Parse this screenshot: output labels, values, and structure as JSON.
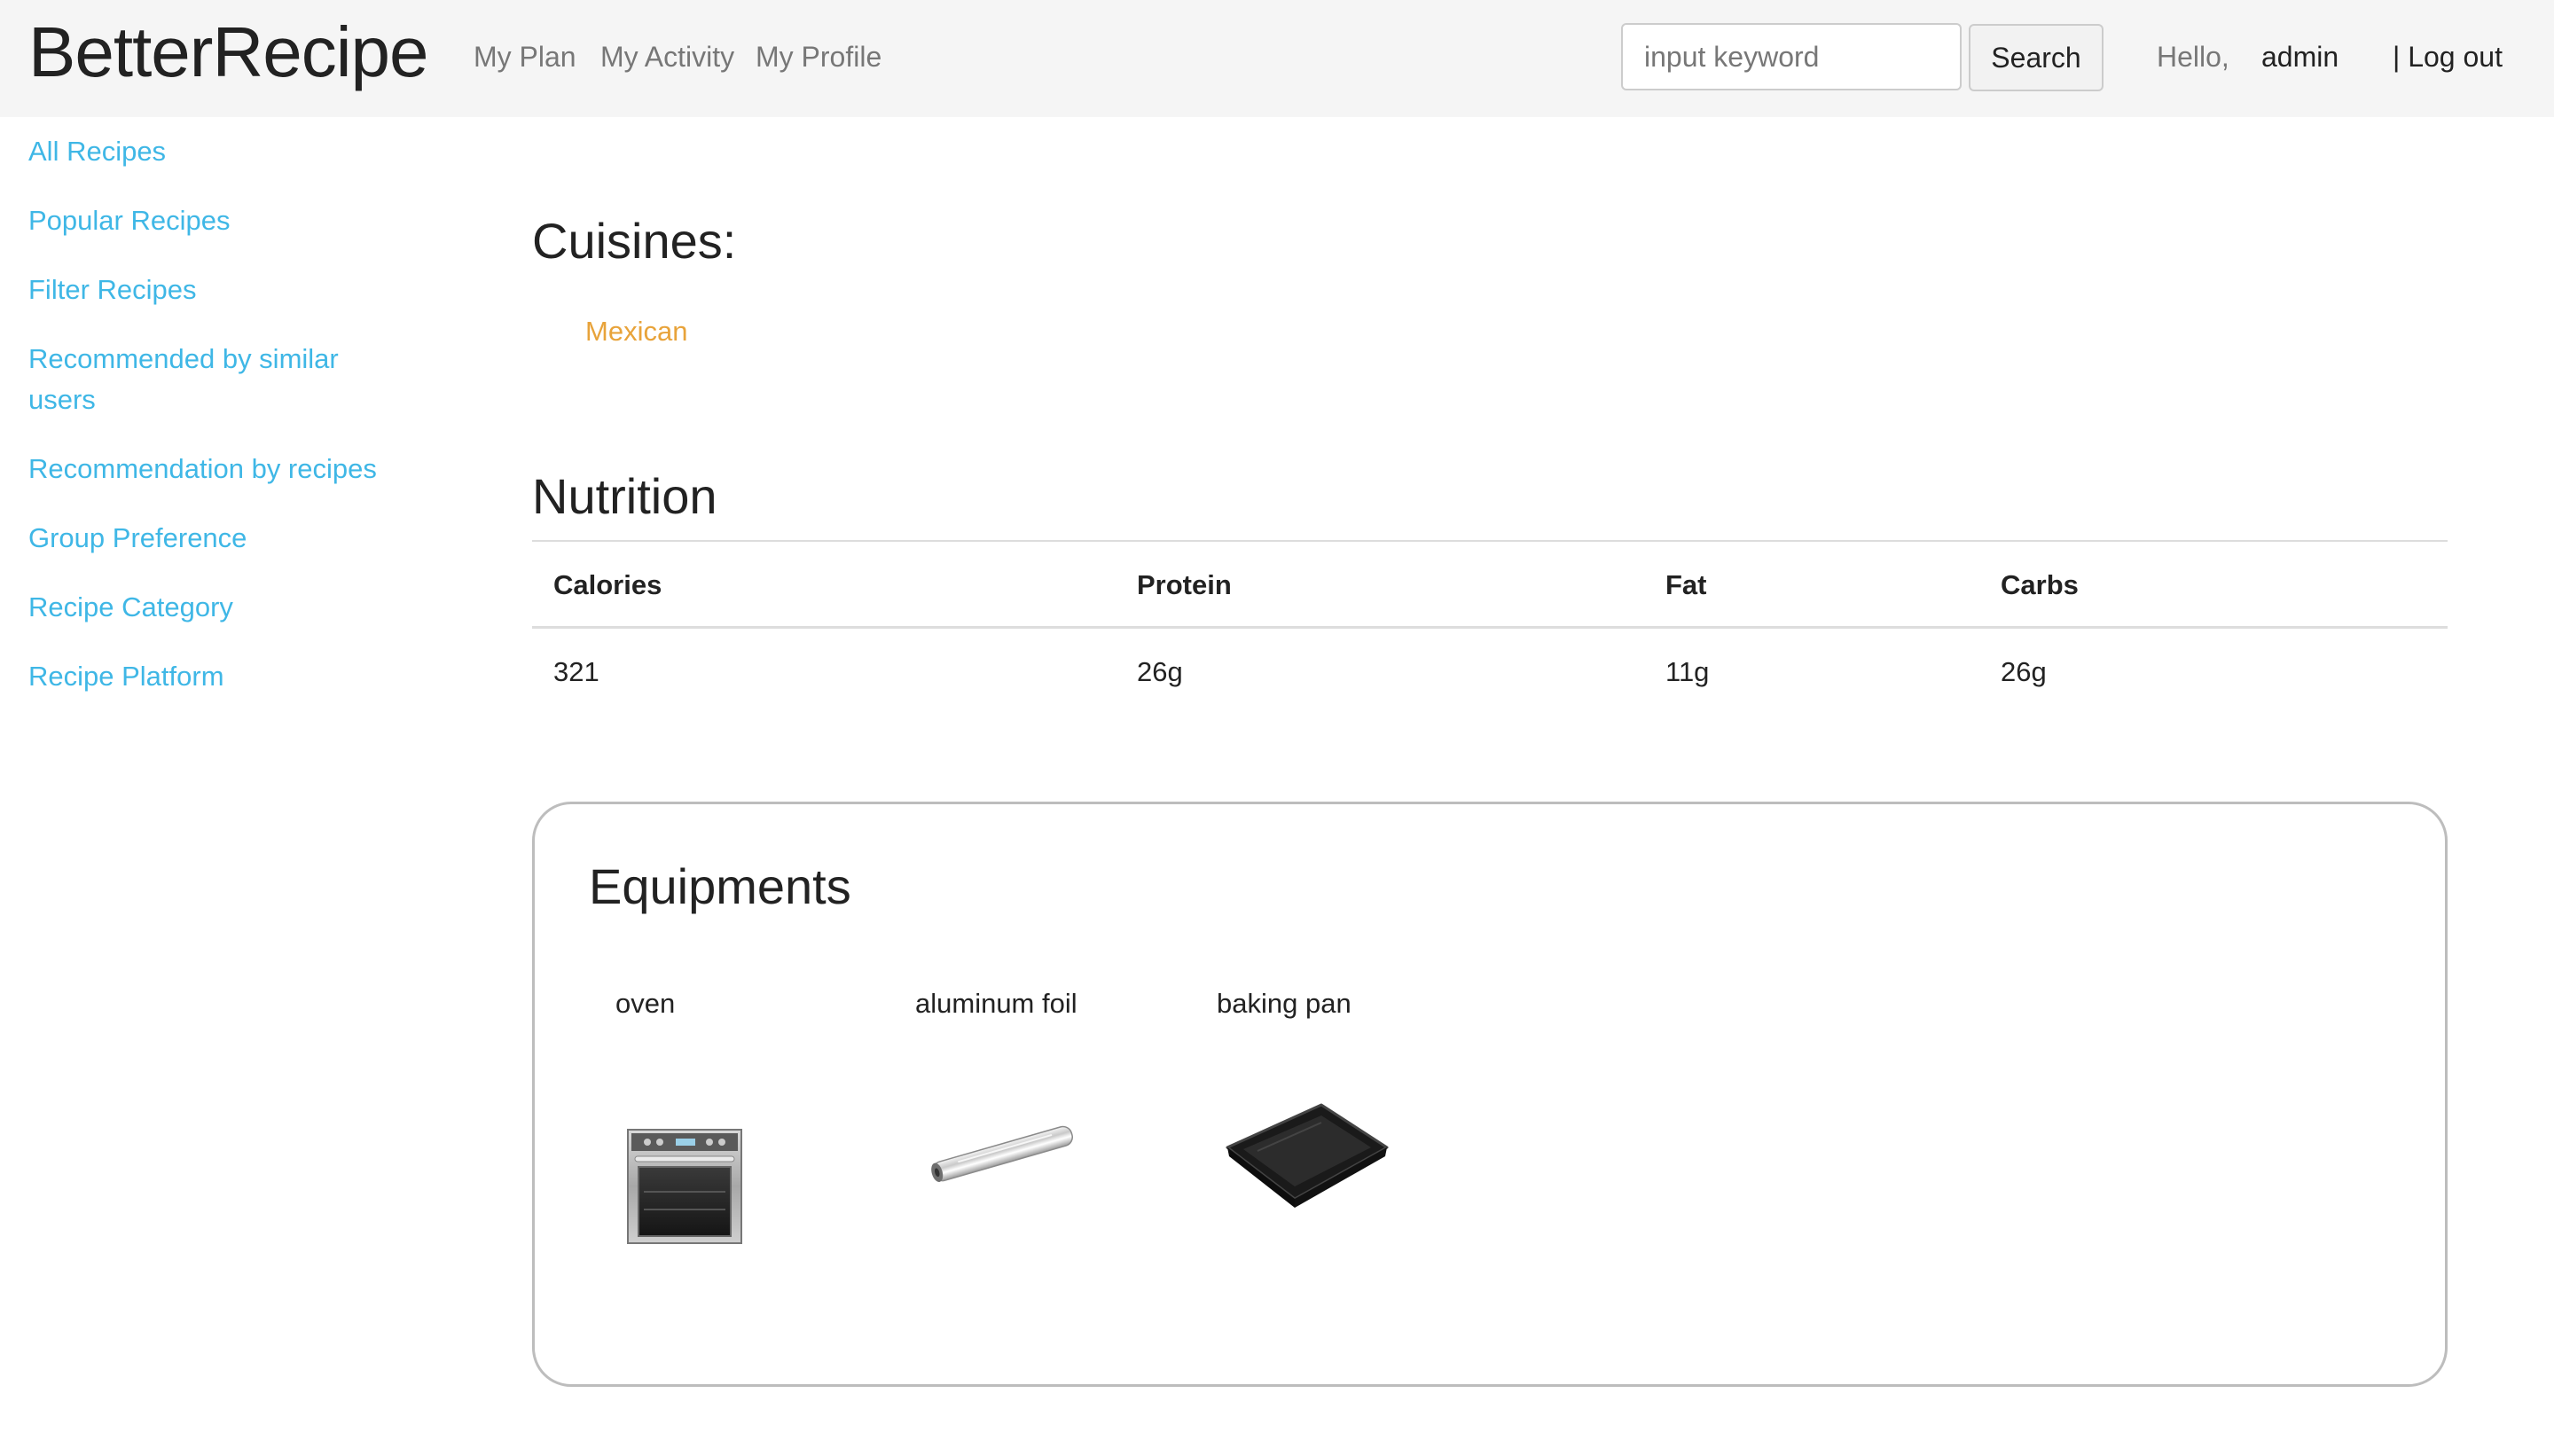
{
  "header": {
    "brand": "BetterRecipe",
    "nav": [
      "My Plan",
      "My Activity",
      "My Profile"
    ],
    "search": {
      "placeholder": "input keyword",
      "value": "",
      "button": "Search"
    },
    "greeting": "Hello,",
    "username": "admin",
    "logout": "| Log out"
  },
  "sidebar": {
    "items": [
      "All Recipes",
      "Popular Recipes",
      "Filter Recipes",
      "Recommended by similar users",
      "Recommendation by recipes",
      "Group Preference",
      "Recipe Category",
      "Recipe Platform"
    ]
  },
  "cuisines": {
    "title": "Cuisines:",
    "items": [
      "Mexican"
    ]
  },
  "nutrition": {
    "title": "Nutrition",
    "headers": [
      "Calories",
      "Protein",
      "Fat",
      "Carbs"
    ],
    "values": [
      "321",
      "26g",
      "11g",
      "26g"
    ]
  },
  "equipments": {
    "title": "Equipments",
    "items": [
      {
        "name": "oven",
        "icon": "oven-image"
      },
      {
        "name": "aluminum foil",
        "icon": "aluminum-foil-image"
      },
      {
        "name": "baking pan",
        "icon": "baking-pan-image"
      }
    ]
  },
  "colors": {
    "link": "#3fb7e6",
    "cuisine": "#e8a33a",
    "navbar_bg": "#f5f5f5"
  }
}
